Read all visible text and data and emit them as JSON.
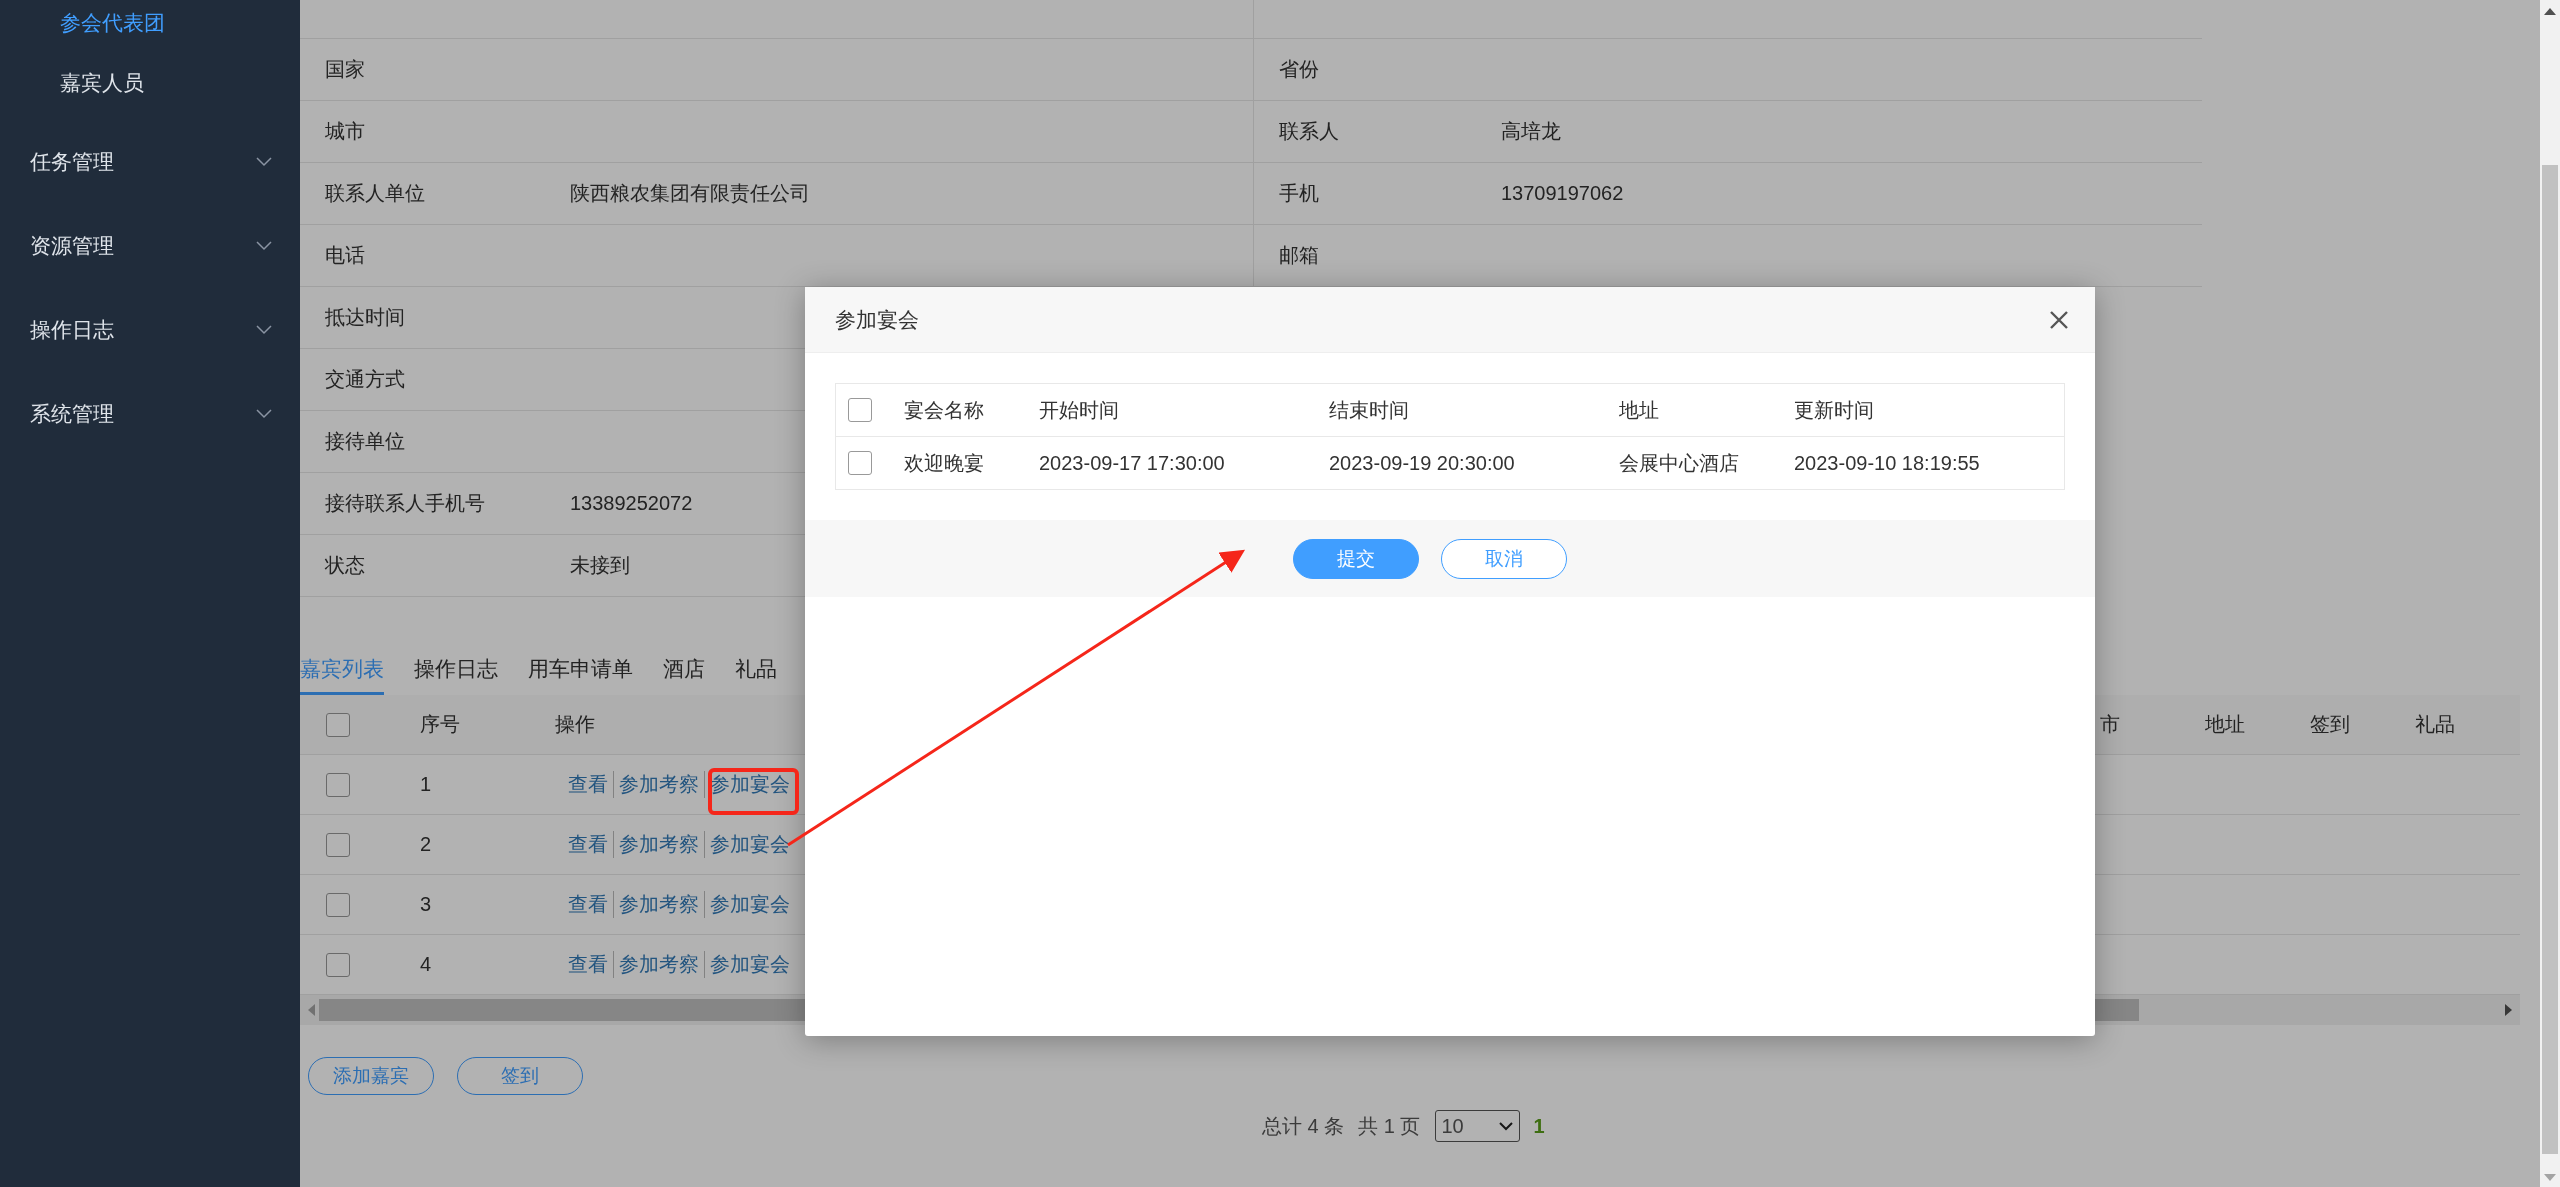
{
  "sidebar": {
    "items": [
      {
        "kind": "sub",
        "label": "参会代表团",
        "selected": true
      },
      {
        "kind": "sub",
        "label": "嘉宾人员",
        "selected": false
      },
      {
        "kind": "group",
        "label": "任务管理",
        "expanded": false
      },
      {
        "kind": "group",
        "label": "资源管理",
        "expanded": false
      },
      {
        "kind": "group",
        "label": "操作日志",
        "expanded": false
      },
      {
        "kind": "group",
        "label": "系统管理",
        "expanded": false
      }
    ]
  },
  "details": {
    "left": [
      {
        "label": "国家"
      },
      {
        "label": "城市"
      },
      {
        "label": "联系人单位",
        "value": "陕西粮农集团有限责任公司"
      },
      {
        "label": "电话"
      },
      {
        "label": "抵达时间"
      },
      {
        "label": "交通方式"
      },
      {
        "label": "接待单位"
      },
      {
        "label": "接待联系人手机号",
        "value": "13389252072"
      },
      {
        "label": "状态",
        "value": "未接到"
      }
    ],
    "right": [
      {
        "label": "省份"
      },
      {
        "label": "联系人",
        "value": "高培龙"
      },
      {
        "label": "手机",
        "value": "13709197062"
      },
      {
        "label": "邮箱"
      }
    ]
  },
  "tabs": [
    {
      "label": "嘉宾列表",
      "selected": true
    },
    {
      "label": "操作日志",
      "selected": false
    },
    {
      "label": "用车申请单",
      "selected": false
    },
    {
      "label": "酒店",
      "selected": false
    },
    {
      "label": "礼品",
      "selected": false
    }
  ],
  "guest_table": {
    "header_checked": false,
    "columns_left": [
      "序号",
      "操作"
    ],
    "columns_right": [
      "市",
      "地址",
      "签到",
      "礼品"
    ],
    "rows": [
      {
        "checked": false,
        "index": "1",
        "actions": [
          "查看",
          "参加考察",
          "参加宴会"
        ]
      },
      {
        "checked": false,
        "index": "2",
        "actions": [
          "查看",
          "参加考察",
          "参加宴会"
        ]
      },
      {
        "checked": false,
        "index": "3",
        "actions": [
          "查看",
          "参加考察",
          "参加宴会"
        ]
      },
      {
        "checked": false,
        "index": "4",
        "actions": [
          "查看",
          "参加考察",
          "参加宴会"
        ]
      }
    ]
  },
  "buttons": [
    "添加嘉宾",
    "签到"
  ],
  "pagination": {
    "total": "总计 4 条",
    "pages": "共 1 页",
    "page_size": "10",
    "current_page": "1"
  },
  "modal": {
    "title": "参加宴会",
    "header_checked": false,
    "columns": [
      "宴会名称",
      "开始时间",
      "结束时间",
      "地址",
      "更新时间"
    ],
    "rows": [
      {
        "checked": false,
        "cells": [
          "欢迎晚宴",
          "2023-09-17 17:30:00",
          "2023-09-19 20:30:00",
          "会展中心酒店",
          "2023-09-10 18:19:55"
        ]
      }
    ],
    "buttons": [
      {
        "kind": "primary",
        "label": "提交"
      },
      {
        "kind": "default",
        "label": "取消"
      }
    ]
  }
}
